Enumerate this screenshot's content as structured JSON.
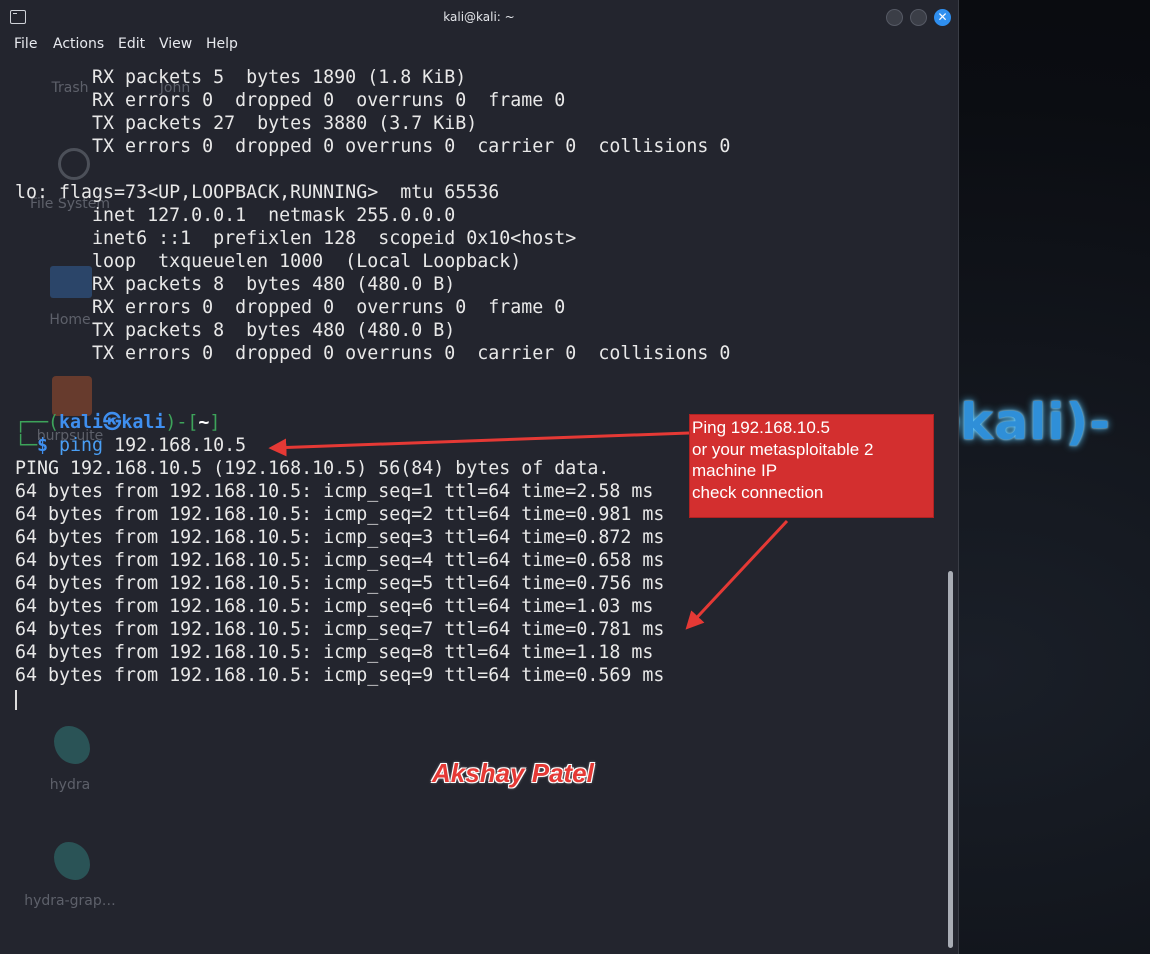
{
  "window": {
    "title": "kali@kali: ~"
  },
  "menu": [
    "File",
    "Actions",
    "Edit",
    "View",
    "Help"
  ],
  "desktop_icons": [
    "Trash",
    "John",
    "File System",
    "Home",
    "burpsuite",
    "hydra",
    "hydra-grap…"
  ],
  "desktop_banner": "(kali㉿kali)-",
  "terminal_lines": [
    "       RX packets 5  bytes 1890 (1.8 KiB)",
    "       RX errors 0  dropped 0  overruns 0  frame 0",
    "       TX packets 27  bytes 3880 (3.7 KiB)",
    "       TX errors 0  dropped 0 overruns 0  carrier 0  collisions 0",
    "",
    "lo: flags=73<UP,LOOPBACK,RUNNING>  mtu 65536",
    "       inet 127.0.0.1  netmask 255.0.0.0",
    "       inet6 ::1  prefixlen 128  scopeid 0x10<host>",
    "       loop  txqueuelen 1000  (Local Loopback)",
    "       RX packets 8  bytes 480 (480.0 B)",
    "       RX errors 0  dropped 0  overruns 0  frame 0",
    "       TX packets 8  bytes 480 (480.0 B)",
    "       TX errors 0  dropped 0 overruns 0  carrier 0  collisions 0"
  ],
  "prompt": {
    "open": "┌──(",
    "user_host": "kali㉿kali",
    "mid": ")-[",
    "dir": "~",
    "close": "]",
    "second": "└─",
    "dollar": "$ ",
    "command": "ping",
    "args": " 192.168.10.5"
  },
  "output_lines": [
    "PING 192.168.10.5 (192.168.10.5) 56(84) bytes of data.",
    "64 bytes from 192.168.10.5: icmp_seq=1 ttl=64 time=2.58 ms",
    "64 bytes from 192.168.10.5: icmp_seq=2 ttl=64 time=0.981 ms",
    "64 bytes from 192.168.10.5: icmp_seq=3 ttl=64 time=0.872 ms",
    "64 bytes from 192.168.10.5: icmp_seq=4 ttl=64 time=0.658 ms",
    "64 bytes from 192.168.10.5: icmp_seq=5 ttl=64 time=0.756 ms",
    "64 bytes from 192.168.10.5: icmp_seq=6 ttl=64 time=1.03 ms",
    "64 bytes from 192.168.10.5: icmp_seq=7 ttl=64 time=0.781 ms",
    "64 bytes from 192.168.10.5: icmp_seq=8 ttl=64 time=1.18 ms",
    "64 bytes from 192.168.10.5: icmp_seq=9 ttl=64 time=0.569 ms"
  ],
  "annotation": {
    "lines": [
      "Ping 192.168.10.5",
      "or your metasploitable 2",
      "machine IP",
      "check connection"
    ]
  },
  "author": "Akshay Patel",
  "colors": {
    "accent": "#2f8fef",
    "note_bg": "#d32f2f",
    "terminal_bg": "#23252e"
  }
}
